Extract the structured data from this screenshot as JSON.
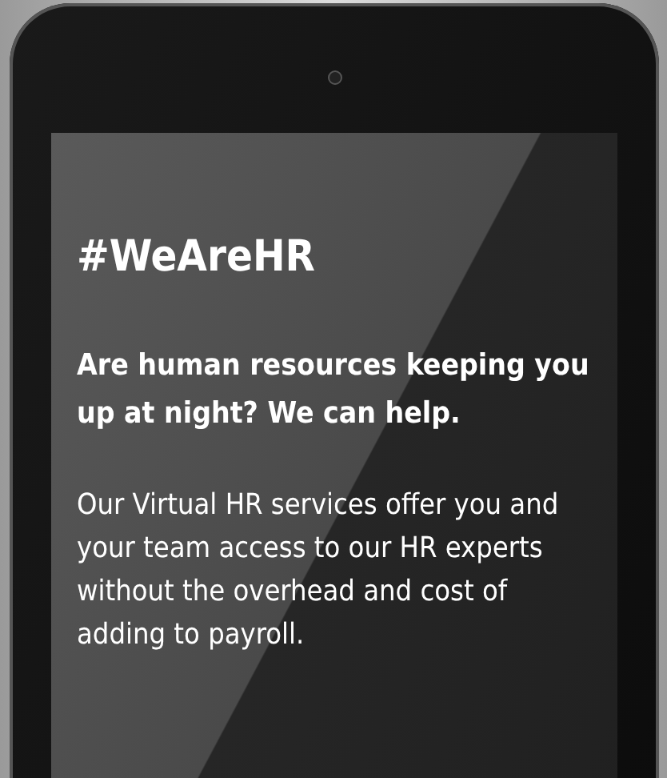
{
  "tablet": {
    "screen": {
      "hashtag": "#WeAreHR",
      "headline": "Are human resources keeping you up at night? We can help.",
      "body": "Our Virtual HR services offer you and your team access to our HR experts without the overhead and cost of adding to payroll."
    }
  }
}
